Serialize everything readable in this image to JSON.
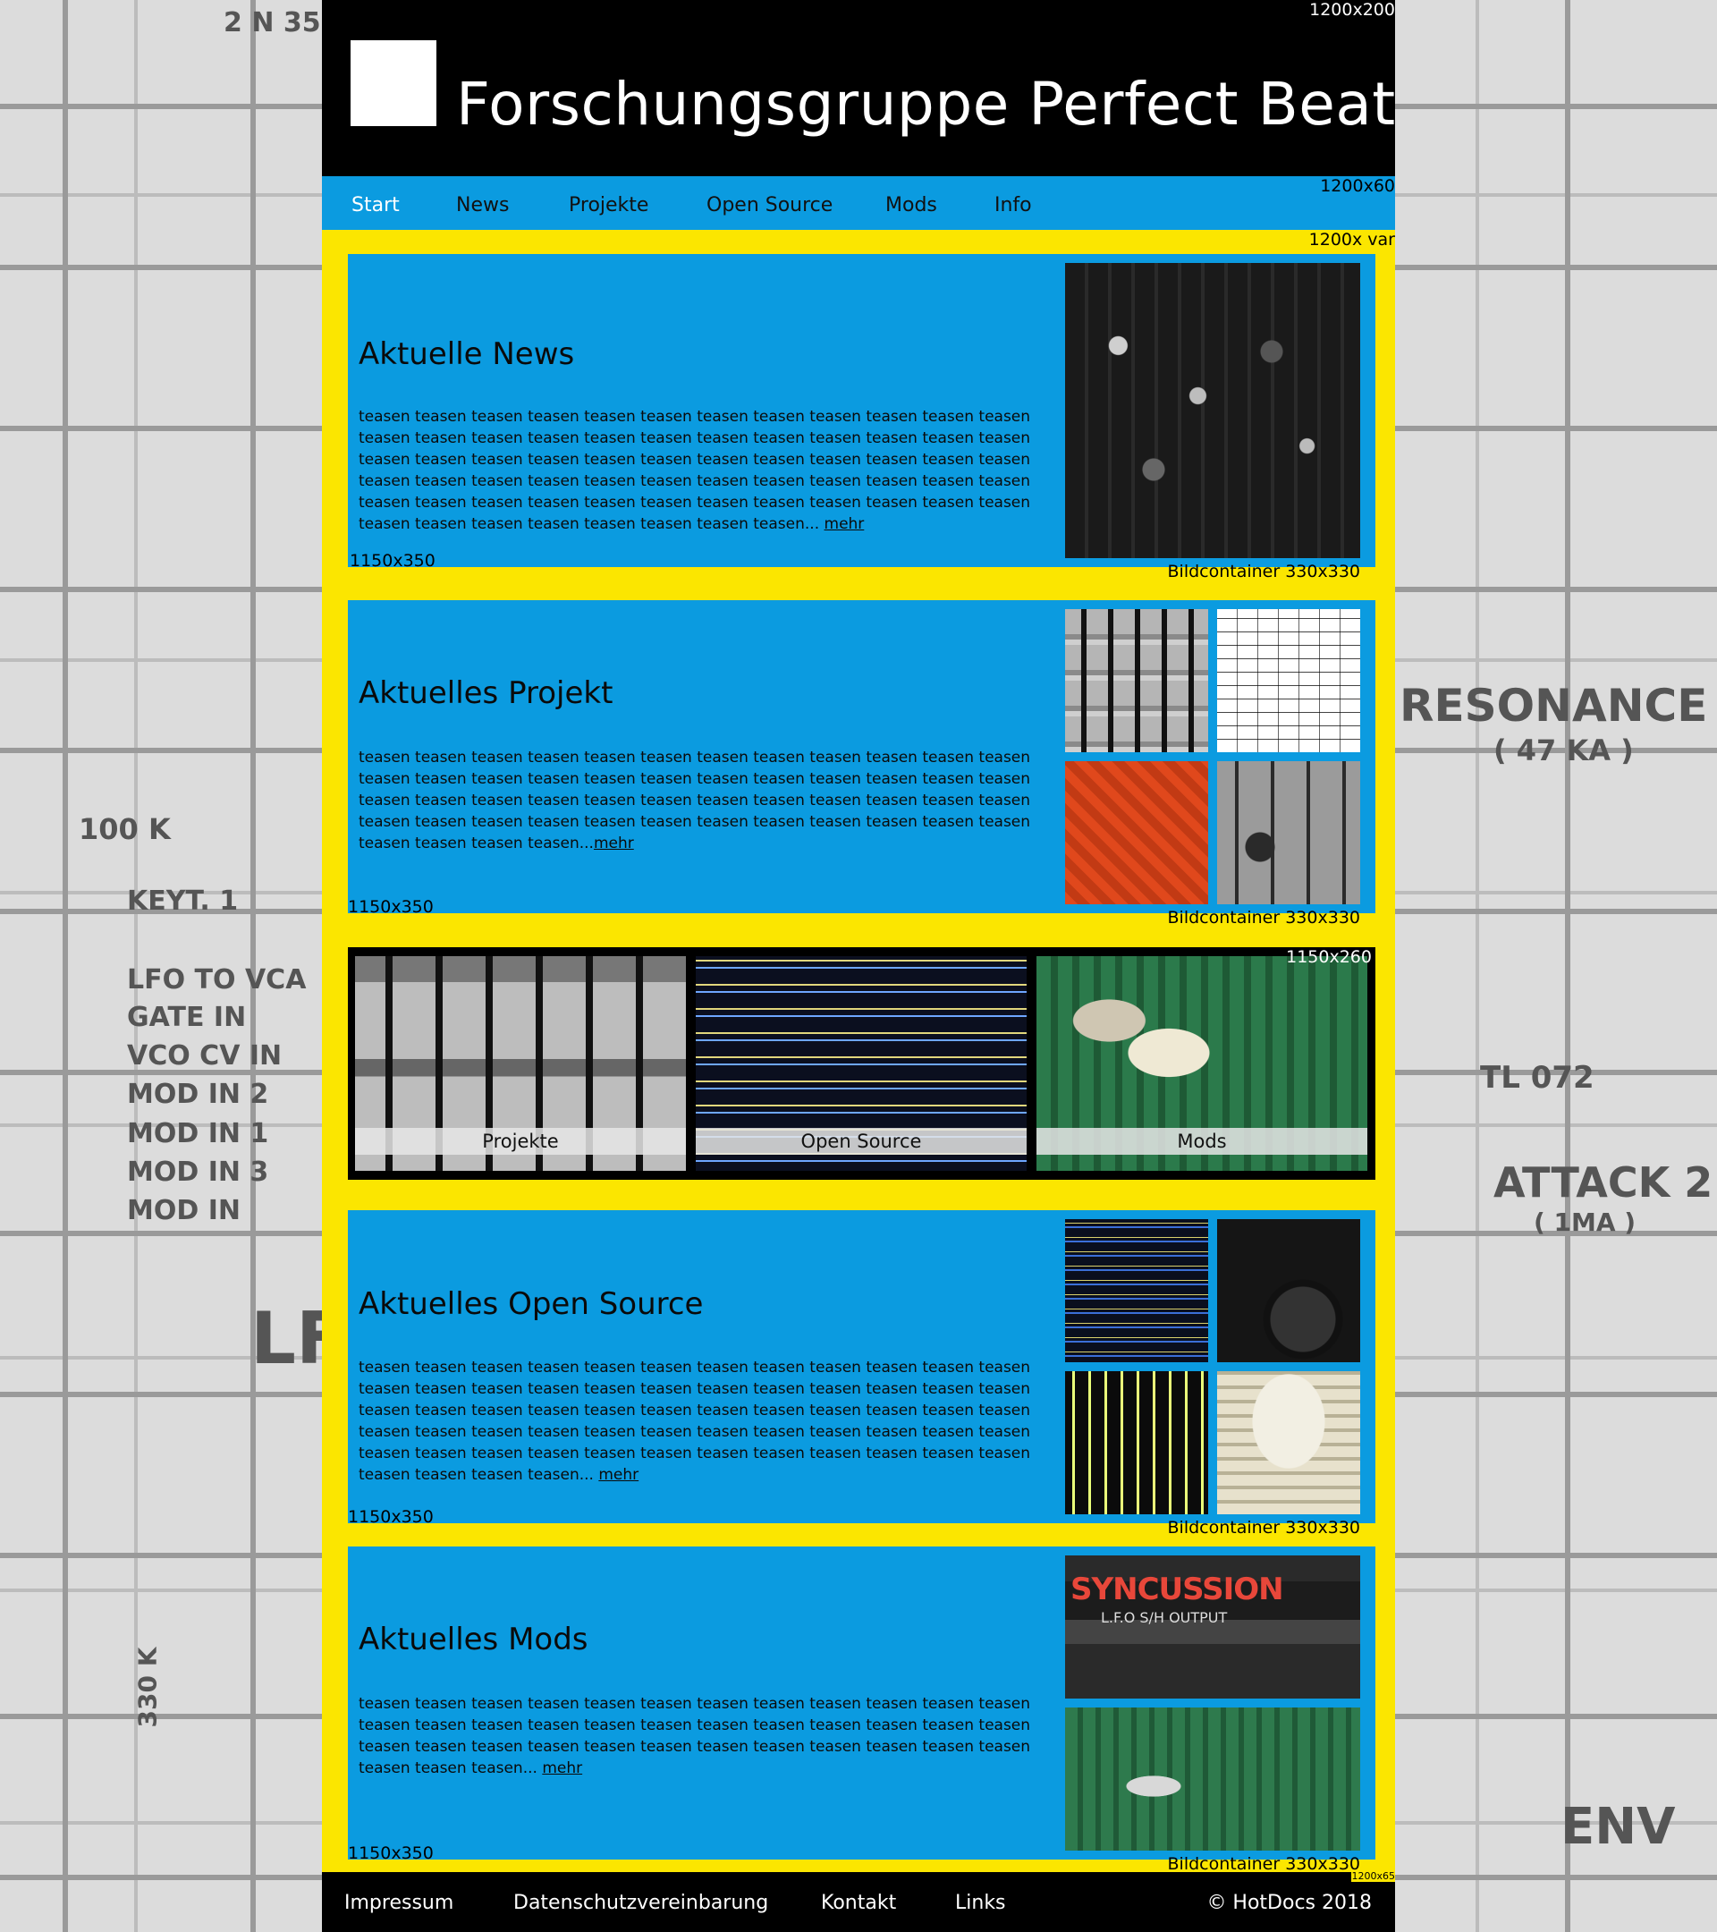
{
  "header": {
    "title": "Forschungsgruppe Perfect Beat",
    "size_label": "1200x200"
  },
  "nav": {
    "items": [
      {
        "label": "Start"
      },
      {
        "label": "News"
      },
      {
        "label": "Projekte"
      },
      {
        "label": "Open Source"
      },
      {
        "label": "Mods"
      },
      {
        "label": "Info"
      }
    ],
    "size_label": "1200x60"
  },
  "content": {
    "size_label": "1200x var"
  },
  "sections": [
    {
      "title": "Aktuelle News",
      "teaser": "teasen teasen teasen teasen teasen teasen teasen teasen teasen teasen teasen teasen teasen teasen teasen teasen teasen teasen teasen teasen teasen teasen teasen teasen teasen teasen teasen teasen teasen teasen teasen teasen teasen teasen teasen teasen teasen teasen teasen teasen teasen teasen teasen teasen teasen teasen teasen teasen teasen teasen teasen teasen teasen teasen teasen teasen teasen teasen teasen teasen teasen teasen teasen teasen teasen teasen teasen teasen...",
      "more": "mehr",
      "size_label": "1150x350",
      "image_label": "Bildcontainer 330x330"
    },
    {
      "title": "Aktuelles Projekt",
      "teaser": "teasen teasen teasen teasen teasen teasen teasen teasen teasen teasen teasen teasen teasen teasen teasen teasen teasen teasen teasen teasen teasen teasen teasen teasen teasen teasen teasen teasen teasen teasen teasen teasen teasen teasen teasen teasen teasen teasen teasen teasen teasen teasen teasen teasen teasen teasen teasen teasen teasen teasen teasen teasen...",
      "more": "mehr",
      "size_label": "1150x350",
      "image_label": "Bildcontainer 330x330"
    },
    {
      "title": "Aktuelles Open Source",
      "teaser": "teasen teasen teasen teasen teasen teasen teasen teasen teasen teasen teasen teasen teasen teasen teasen teasen teasen teasen teasen teasen teasen teasen teasen teasen teasen teasen teasen teasen teasen teasen teasen teasen teasen teasen teasen teasen teasen teasen teasen teasen teasen teasen teasen teasen teasen teasen teasen teasen teasen teasen teasen teasen teasen teasen teasen teasen teasen teasen teasen teasen teasen teasen teasen teasen...",
      "more": "mehr",
      "size_label": "1150x350",
      "image_label": "Bildcontainer 330x330"
    },
    {
      "title": "Aktuelles Mods",
      "teaser": "teasen teasen teasen teasen teasen teasen teasen teasen teasen teasen teasen teasen teasen teasen teasen teasen teasen teasen teasen teasen teasen teasen teasen teasen teasen teasen teasen teasen teasen teasen teasen teasen teasen teasen teasen teasen teasen teasen teasen...",
      "more": "mehr",
      "size_label": "1150x350",
      "image_label": "Bildcontainer 330x330"
    }
  ],
  "strip": {
    "size_label": "1150x260",
    "tiles": [
      {
        "label": "Projekte"
      },
      {
        "label": "Open Source"
      },
      {
        "label": "Mods"
      }
    ]
  },
  "mods_image": {
    "brand": "SYNCUSSION",
    "panel": "L.F.O   S/H   OUTPUT"
  },
  "footer": {
    "links": [
      {
        "label": "Impressum"
      },
      {
        "label": "Datenschutzvereinbarung"
      },
      {
        "label": "Kontakt"
      },
      {
        "label": "Links"
      }
    ],
    "copyright": "© HotDocs 2018",
    "size_label": "1200x65"
  },
  "background": {
    "labels": [
      "2 N 35",
      "RESONANCE",
      "( 47 KA )",
      "ATTACK 2",
      "( 1MA )",
      "TL 072",
      "ENV",
      "LF",
      "KEYT. 1",
      "LFO TO VCA",
      "GATE IN",
      "VCO CV IN",
      "MOD IN 2",
      "MOD IN 1",
      "MOD IN 3",
      "MOD IN",
      "100 K",
      "330 K"
    ]
  },
  "colors": {
    "header_bg": "#000000",
    "nav_bg": "#0b9be0",
    "content_bg": "#fbe600",
    "card_bg": "#0b9be0",
    "footer_bg": "#000000"
  }
}
